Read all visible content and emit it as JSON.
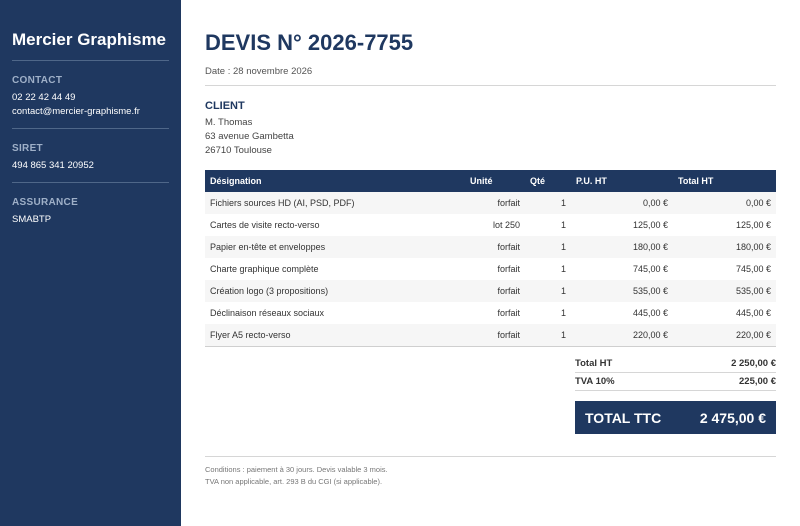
{
  "sidebar": {
    "brand": "Mercier Graphisme",
    "sections": [
      {
        "label": "CONTACT",
        "values": [
          "02 22 42 44 49",
          "contact@mercier-graphisme.fr"
        ]
      },
      {
        "label": "SIRET",
        "values": [
          "494 865 341 20952"
        ]
      },
      {
        "label": "ASSURANCE",
        "values": [
          "SMABTP"
        ]
      }
    ]
  },
  "header": {
    "title": "DEVIS N° 2026-7755",
    "date": "Date : 28 novembre 2026"
  },
  "client": {
    "heading": "CLIENT",
    "lines": [
      "M. Thomas",
      "63 avenue Gambetta",
      "26710 Toulouse"
    ]
  },
  "table": {
    "headers": [
      "Désignation",
      "Unité",
      "Qté",
      "P.U. HT",
      "Total HT"
    ],
    "rows": [
      [
        "Fichiers sources HD (AI, PSD, PDF)",
        "forfait",
        "1",
        "0,00 €",
        "0,00 €"
      ],
      [
        "Cartes de visite recto-verso",
        "lot 250",
        "1",
        "125,00 €",
        "125,00 €"
      ],
      [
        "Papier en-tête et enveloppes",
        "forfait",
        "1",
        "180,00 €",
        "180,00 €"
      ],
      [
        "Charte graphique complète",
        "forfait",
        "1",
        "745,00 €",
        "745,00 €"
      ],
      [
        "Création logo (3 propositions)",
        "forfait",
        "1",
        "535,00 €",
        "535,00 €"
      ],
      [
        "Déclinaison réseaux sociaux",
        "forfait",
        "1",
        "445,00 €",
        "445,00 €"
      ],
      [
        "Flyer A5 recto-verso",
        "forfait",
        "1",
        "220,00 €",
        "220,00 €"
      ]
    ]
  },
  "totals": {
    "ht_label": "Total HT",
    "ht_value": "2 250,00 €",
    "tva_label": "TVA 10%",
    "tva_value": "225,00 €",
    "ttc_label": "TOTAL TTC",
    "ttc_value": "2 475,00 €"
  },
  "footer": {
    "line1": "Conditions : paiement à 30 jours. Devis valable 3 mois.",
    "line2": "TVA non applicable, art. 293 B du CGI (si applicable)."
  },
  "colors": {
    "navy": "#1f3860",
    "row_stripe": "#f6f6f6"
  }
}
